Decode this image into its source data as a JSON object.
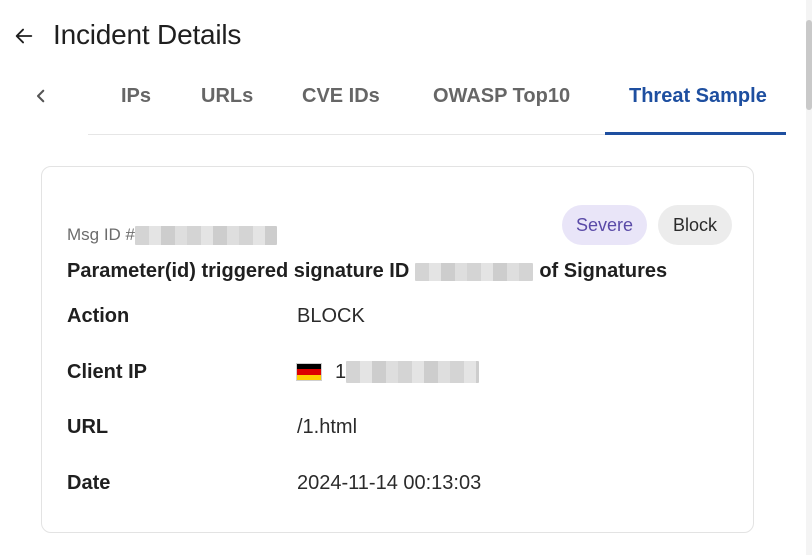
{
  "header": {
    "title": "Incident Details"
  },
  "tabs": {
    "items": [
      {
        "label": "IPs",
        "active": false
      },
      {
        "label": "URLs",
        "active": false
      },
      {
        "label": "CVE IDs",
        "active": false
      },
      {
        "label": "OWASP Top10",
        "active": false
      },
      {
        "label": "Threat Sample",
        "active": true
      }
    ]
  },
  "card": {
    "msg_id_prefix": "Msg ID #",
    "badges": {
      "severity": "Severe",
      "action": "Block"
    },
    "signature": {
      "prefix": "Parameter(id) triggered signature ID",
      "suffix": "of Signatures"
    },
    "rows": [
      {
        "label": "Action",
        "value": "BLOCK"
      },
      {
        "label": "Client IP",
        "value": "1",
        "flag_colors": [
          "#000000",
          "#dd0000",
          "#ffce00"
        ]
      },
      {
        "label": "URL",
        "value": "/1.html"
      },
      {
        "label": "Date",
        "value": "2024-11-14 00:13:03"
      }
    ]
  },
  "colors": {
    "accent": "#1e4fa0",
    "severe_bg": "#e9e5f8",
    "severe_text": "#5a4aa7",
    "block_bg": "#ececec"
  },
  "icons": {
    "back": "arrow-left-icon",
    "tabs_left": "chevron-left-icon"
  }
}
